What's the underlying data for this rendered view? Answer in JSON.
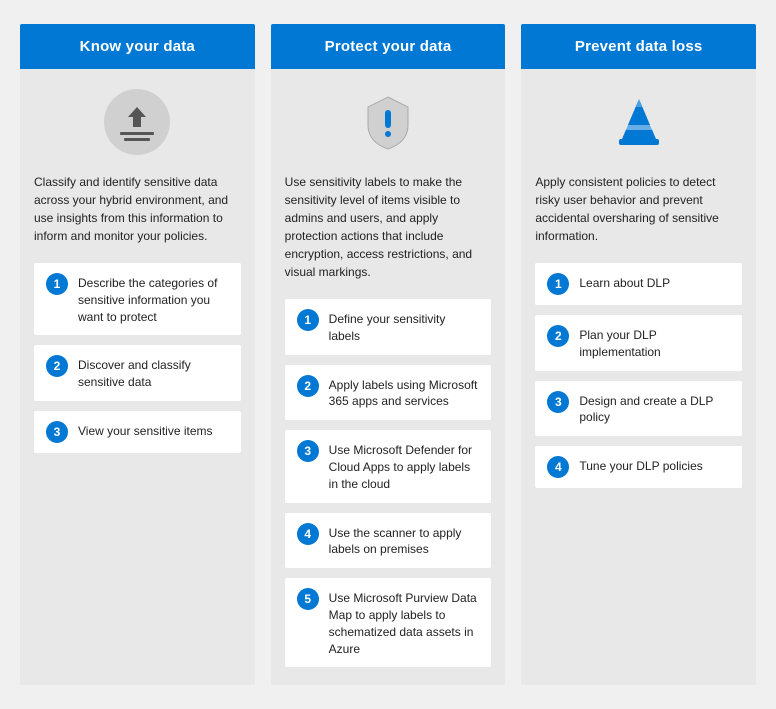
{
  "cards": [
    {
      "id": "know-your-data",
      "header": "Know your data",
      "description": "Classify and identify sensitive data across your hybrid environment, and use insights from this information to inform and monitor your policies.",
      "icon": "classify",
      "steps": [
        {
          "number": "1",
          "text": "Describe the categories of sensitive information you want to protect"
        },
        {
          "number": "2",
          "text": "Discover and classify sensitive data"
        },
        {
          "number": "3",
          "text": "View your sensitive items"
        }
      ]
    },
    {
      "id": "protect-your-data",
      "header": "Protect your data",
      "description": "Use sensitivity labels to make the sensitivity level of items visible to admins and users, and apply protection actions that include encryption, access restrictions, and visual markings.",
      "icon": "shield",
      "steps": [
        {
          "number": "1",
          "text": "Define your sensitivity labels"
        },
        {
          "number": "2",
          "text": "Apply labels using Microsoft 365 apps and services"
        },
        {
          "number": "3",
          "text": "Use Microsoft Defender for Cloud Apps to apply labels in the cloud"
        },
        {
          "number": "4",
          "text": "Use the scanner to apply labels on premises"
        },
        {
          "number": "5",
          "text": "Use Microsoft Purview Data Map to apply labels to schematized data assets in Azure"
        }
      ]
    },
    {
      "id": "prevent-data-loss",
      "header": "Prevent data loss",
      "description": "Apply consistent policies to detect risky user behavior and prevent accidental oversharing of sensitive information.",
      "icon": "cone",
      "steps": [
        {
          "number": "1",
          "text": "Learn about DLP"
        },
        {
          "number": "2",
          "text": "Plan your DLP implementation"
        },
        {
          "number": "3",
          "text": "Design and create a DLP policy"
        },
        {
          "number": "4",
          "text": "Tune your DLP policies"
        }
      ]
    }
  ]
}
